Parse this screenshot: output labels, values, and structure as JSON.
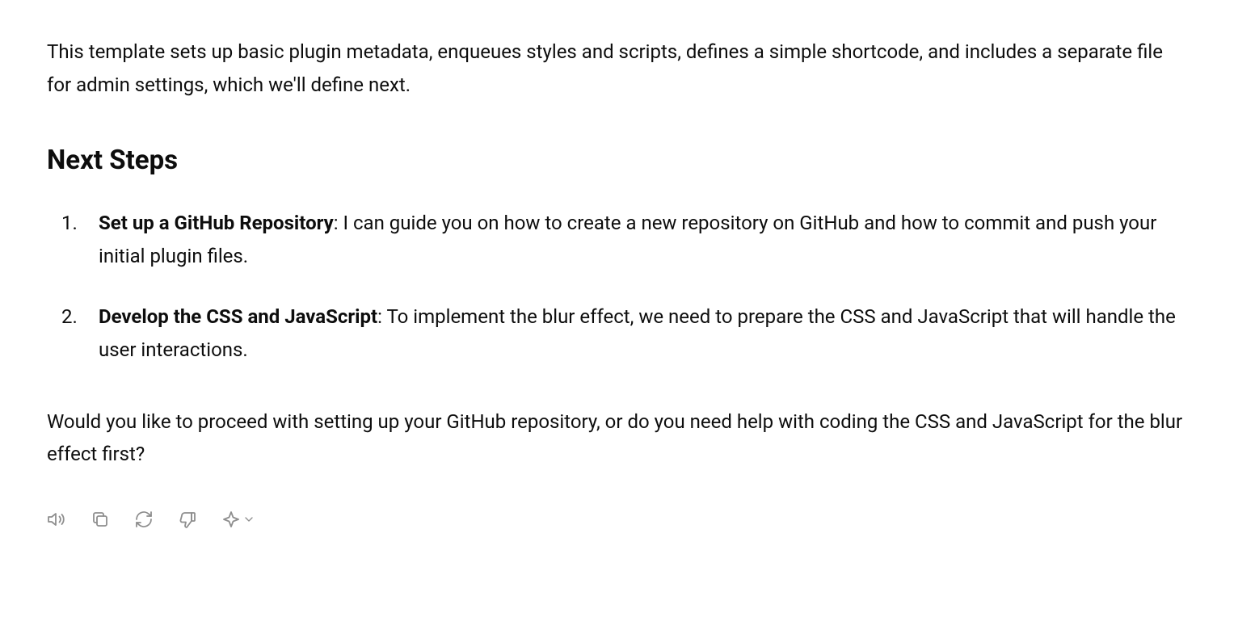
{
  "intro": "This template sets up basic plugin metadata, enqueues styles and scripts, defines a simple shortcode, and includes a separate file for admin settings, which we'll define next.",
  "heading": "Next Steps",
  "steps": [
    {
      "title": "Set up a GitHub Repository",
      "body": ": I can guide you on how to create a new repository on GitHub and how to commit and push your initial plugin files."
    },
    {
      "title": "Develop the CSS and JavaScript",
      "body": ": To implement the blur effect, we need to prepare the CSS and JavaScript that will handle the user interactions."
    }
  ],
  "closing": "Would you like to proceed with setting up your GitHub repository, or do you need help with coding the CSS and JavaScript for the blur effect first?",
  "toolbar": {
    "speak": "Read aloud",
    "copy": "Copy",
    "regenerate": "Regenerate",
    "dislike": "Bad response",
    "model": "Change model"
  }
}
